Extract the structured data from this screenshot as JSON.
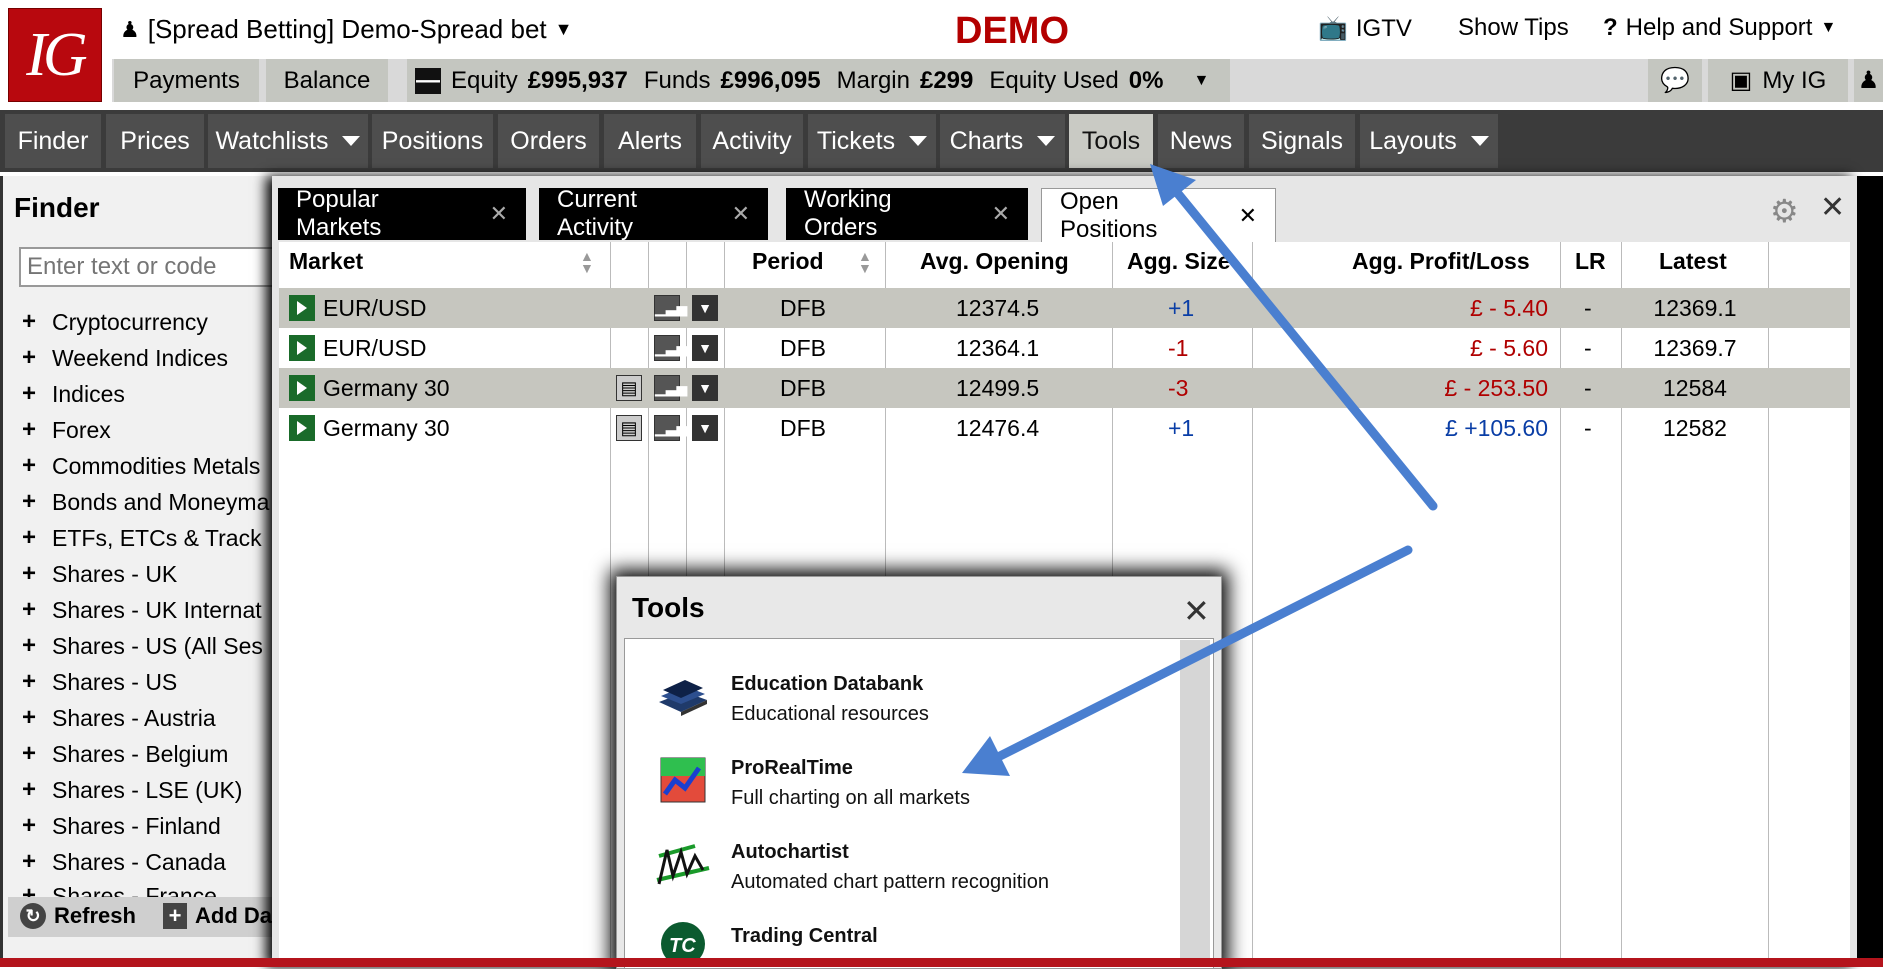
{
  "header": {
    "logo_text": "IG",
    "account_label": "[Spread Betting] Demo-Spread bet",
    "mode": "DEMO",
    "links": {
      "igtv": "IGTV",
      "show_tips": "Show Tips",
      "help": "Help and Support"
    },
    "payments": "Payments",
    "balance": "Balance",
    "equity_label": "Equity",
    "equity_value": "£995,937",
    "funds_label": "Funds",
    "funds_value": "£996,095",
    "margin_label": "Margin",
    "margin_value": "£299",
    "equity_used_label": "Equity Used",
    "equity_used_value": "0%",
    "my_ig": "My IG"
  },
  "nav": {
    "items": [
      "Finder",
      "Prices",
      "Watchlists",
      "Positions",
      "Orders",
      "Alerts",
      "Activity",
      "Tickets",
      "Charts",
      "Tools",
      "News",
      "Signals",
      "Layouts"
    ],
    "active": "Tools"
  },
  "finder": {
    "title": "Finder",
    "search_placeholder": "Enter text or code",
    "categories": [
      "Cryptocurrency",
      "Weekend Indices",
      "Indices",
      "Forex",
      "Commodities Metals",
      "Bonds and Moneyma",
      "ETFs, ETCs & Track",
      "Shares - UK",
      "Shares - UK Internat",
      "Shares - US (All Ses",
      "Shares - US",
      "Shares - Austria",
      "Shares - Belgium",
      "Shares - LSE (UK)",
      "Shares - Finland",
      "Shares - Canada",
      "Shares - France"
    ],
    "refresh": "Refresh",
    "add": "Add Da"
  },
  "tabs": [
    {
      "label": "Popular Markets",
      "active": false
    },
    {
      "label": "Current Activity",
      "active": false
    },
    {
      "label": "Working Orders",
      "active": false
    },
    {
      "label": "Open Positions",
      "active": true
    }
  ],
  "table": {
    "headers": {
      "market": "Market",
      "period": "Period",
      "avg_opening": "Avg. Opening",
      "agg_size": "Agg. Size",
      "agg_pl": "Agg. Profit/Loss",
      "lr": "LR",
      "latest": "Latest"
    },
    "rows": [
      {
        "market": "EUR/USD",
        "period": "DFB",
        "avg": "12374.5",
        "size": "+1",
        "pl": "£ - 5.40",
        "lr": "-",
        "latest": "12369.1"
      },
      {
        "market": "EUR/USD",
        "period": "DFB",
        "avg": "12364.1",
        "size": "-1",
        "pl": "£ - 5.60",
        "lr": "-",
        "latest": "12369.7"
      },
      {
        "market": "Germany 30",
        "period": "DFB",
        "avg": "12499.5",
        "size": "-3",
        "pl": "£ - 253.50",
        "lr": "-",
        "latest": "12584"
      },
      {
        "market": "Germany 30",
        "period": "DFB",
        "avg": "12476.4",
        "size": "+1",
        "pl": "£ +105.60",
        "lr": "-",
        "latest": "12582"
      }
    ]
  },
  "tools_popup": {
    "title": "Tools",
    "items": [
      {
        "name": "Education Databank",
        "desc": "Educational resources",
        "icon": "books-icon"
      },
      {
        "name": "ProRealTime",
        "desc": "Full charting on all markets",
        "icon": "chart-icon"
      },
      {
        "name": "Autochartist",
        "desc": "Automated chart pattern recognition",
        "icon": "pattern-icon"
      },
      {
        "name": "Trading Central",
        "desc": "",
        "icon": "tc-icon"
      }
    ]
  },
  "colors": {
    "brand_red": "#b8080e",
    "demo_red": "#b30000",
    "annotation_arrow": "#4a7fd0"
  }
}
